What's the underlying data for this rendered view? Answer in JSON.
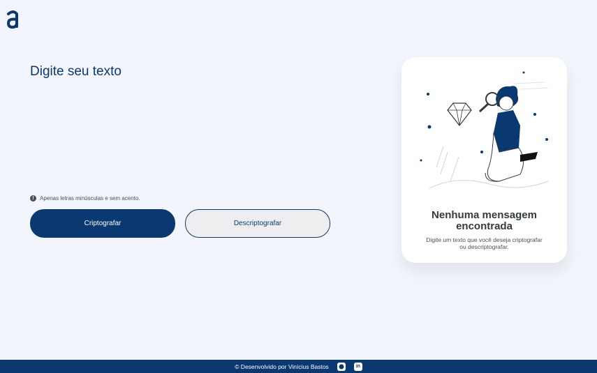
{
  "brand": {
    "logo_alt": "a"
  },
  "input": {
    "placeholder": "Digite seu texto",
    "value": ""
  },
  "hint": {
    "icon": "info-icon",
    "text": "Apenas letras minúsculas e sem acento."
  },
  "buttons": {
    "encrypt_label": "Criptografar",
    "decrypt_label": "Descriptografar"
  },
  "output": {
    "illustration": "person-with-magnifying-glass-and-diamond",
    "title": "Nenhuma mensagem encontrada",
    "text": "Digite um texto que você deseja criptografar ou descriptografar."
  },
  "footer": {
    "text": "© Desenvolvido por Vinícius Bastos",
    "links": [
      {
        "icon": "github-icon",
        "label": ""
      },
      {
        "icon": "linkedin-icon",
        "label": "in"
      }
    ]
  },
  "colors": {
    "background": "#f2f5fc",
    "primary": "#0a3871",
    "secondary_button": "#eeeef1",
    "card": "#ffffff",
    "title_text": "#343a40",
    "muted_text": "#495057"
  }
}
